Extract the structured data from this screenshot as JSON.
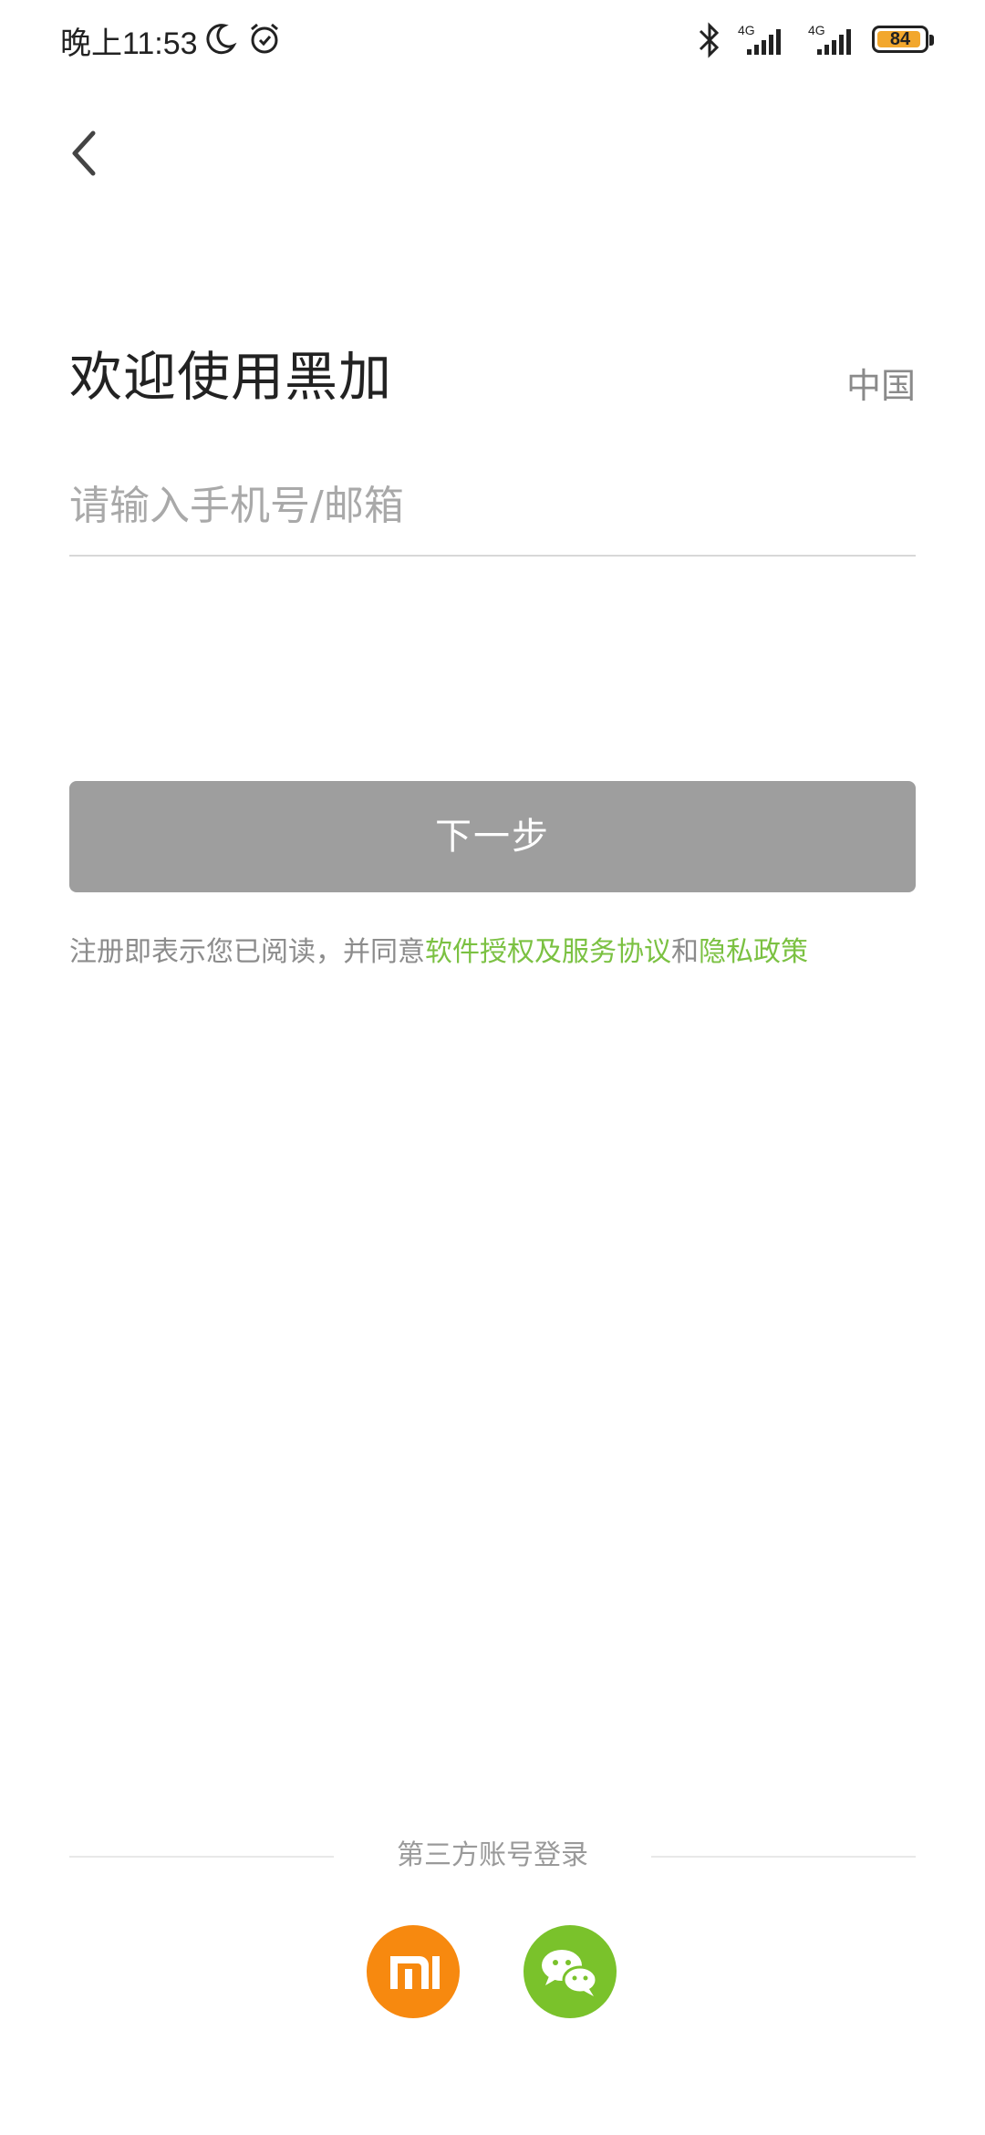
{
  "status_bar": {
    "time": "晚上11:53",
    "battery": "84",
    "network_1": "4G",
    "network_2": "4G"
  },
  "header": {
    "title": "欢迎使用黑加",
    "region": "中国"
  },
  "form": {
    "input_placeholder": "请输入手机号/邮箱",
    "next_label": "下一步"
  },
  "agreement": {
    "prefix": "注册即表示您已阅读，并同意",
    "license_link": "软件授权及服务协议",
    "conjunction": "和",
    "privacy_link": "隐私政策"
  },
  "third_party": {
    "label": "第三方账号登录",
    "providers": [
      "xiaomi-icon",
      "wechat-icon"
    ]
  },
  "colors": {
    "accent_green": "#7bc142",
    "button_disabled": "#9e9e9e",
    "xiaomi_orange": "#f7890f",
    "wechat_green": "#7ac22b"
  }
}
